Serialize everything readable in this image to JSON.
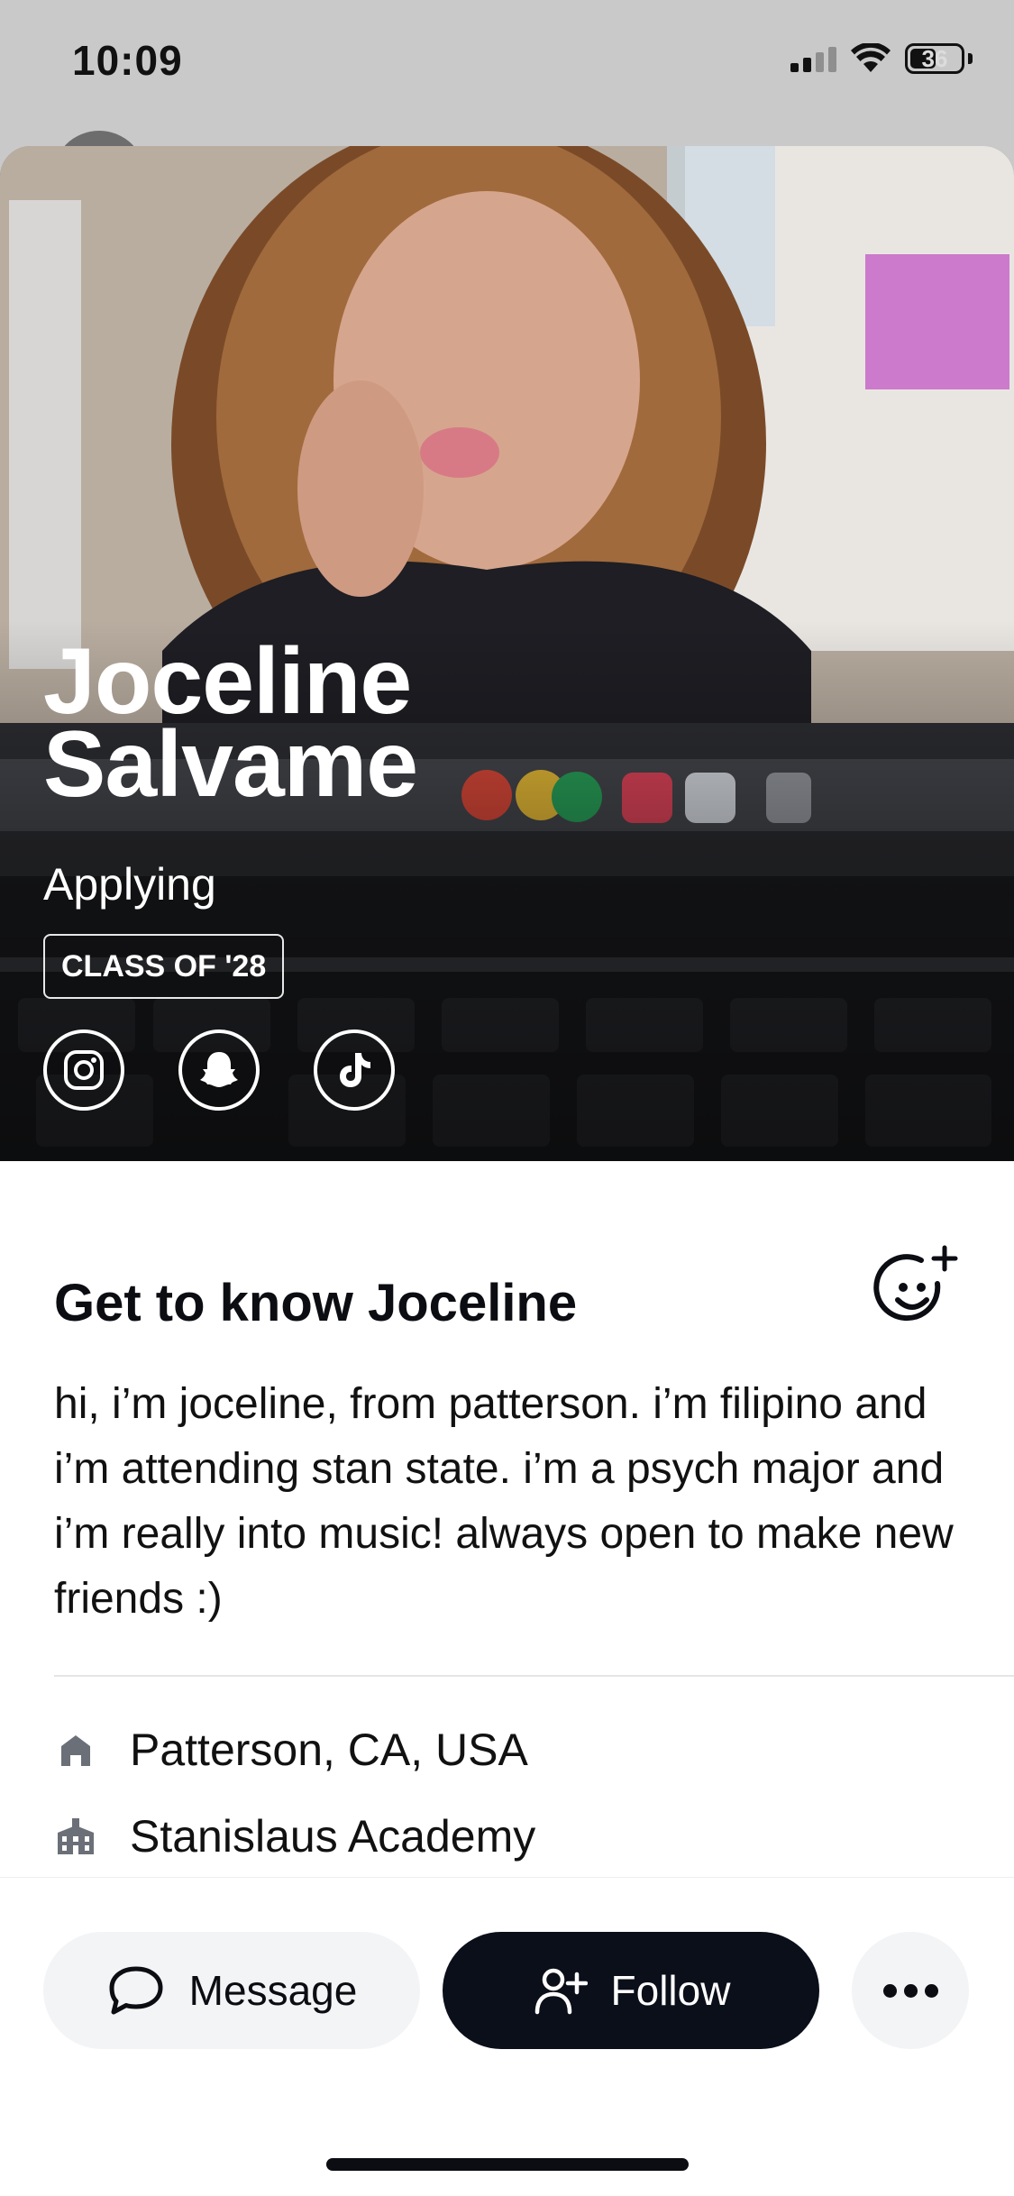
{
  "status_bar": {
    "time": "10:09",
    "battery": "36"
  },
  "profile": {
    "first_name": "Joceline",
    "last_name": "Salvame",
    "status": "Applying",
    "class_badge": "CLASS OF '28",
    "socials": [
      {
        "icon": "instagram-icon"
      },
      {
        "icon": "snapchat-icon"
      },
      {
        "icon": "tiktok-icon"
      }
    ]
  },
  "about": {
    "title": "Get to know Joceline",
    "bio": "hi, i’m joceline, from patterson. i’m filipino and i’m attending stan state. i’m a psych major and i’m really into music! always open to make new friends :)",
    "hometown": "Patterson, CA, USA",
    "school": "Stanislaus Academy"
  },
  "actions": {
    "message_label": "Message",
    "follow_label": "Follow"
  },
  "colors": {
    "primary_dark": "#0b0f1a",
    "secondary_bg": "#f3f4f6",
    "icon_gray": "#6b6f78"
  }
}
